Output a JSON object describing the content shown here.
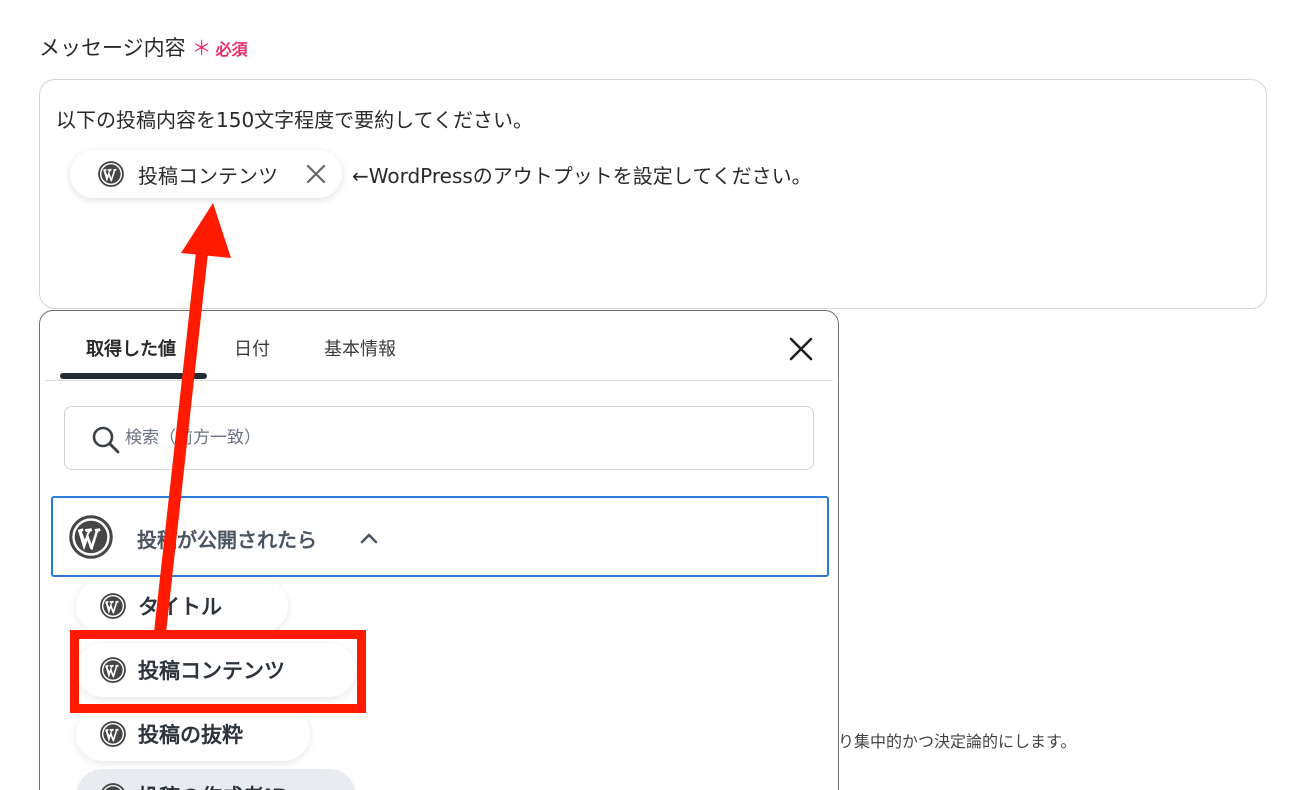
{
  "field": {
    "label": "メッセージ内容",
    "required_mark": "＊",
    "required_text": "必須"
  },
  "message": {
    "line1": "以下の投稿内容を150文字程度で要約してください。",
    "chip_label": "投稿コンテンツ",
    "hint": "←WordPressのアウトプットを設定してください。"
  },
  "panel": {
    "tabs": [
      {
        "label": "取得した値"
      },
      {
        "label": "日付"
      },
      {
        "label": "基本情報"
      }
    ],
    "search": {
      "placeholder": "検索（前方一致）",
      "value": ""
    },
    "group": {
      "label": "投稿が公開されたら"
    },
    "items": [
      {
        "label": "タイトル"
      },
      {
        "label": "投稿コンテンツ"
      },
      {
        "label": "投稿の抜粋"
      },
      {
        "label": "投稿の作成者ID"
      }
    ]
  },
  "background_text": "り集中的かつ決定論的にします。",
  "colors": {
    "required": "#e8306a",
    "focus_border": "#2a7bdc",
    "annotation": "#ff1a00",
    "tab_indicator": "#232b35"
  },
  "icons": {
    "wordpress": "wordpress-logo-icon",
    "close": "close-icon",
    "search": "search-icon",
    "chevron": "chevron-up-icon"
  }
}
